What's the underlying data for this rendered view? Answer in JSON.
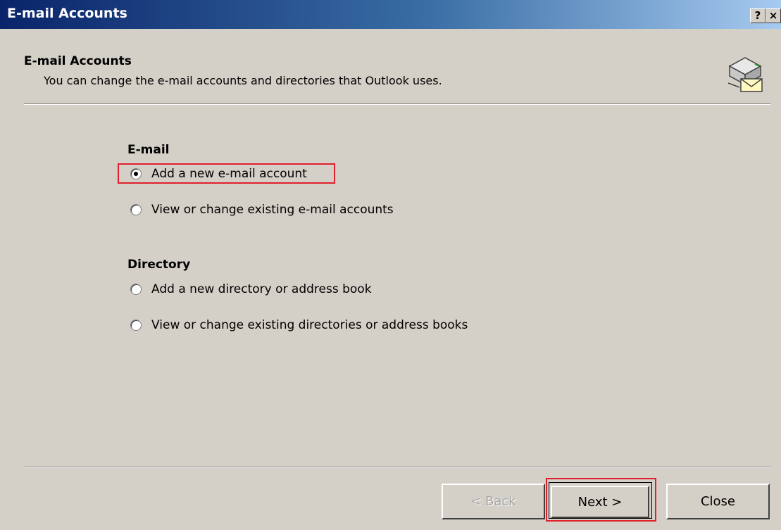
{
  "window": {
    "title": "E-mail Accounts",
    "help_label": "?",
    "close_label": "×"
  },
  "header": {
    "title": "E-mail Accounts",
    "description": "You can change the e-mail accounts and directories that Outlook uses.",
    "icon": "mail-server-icon"
  },
  "email_group": {
    "heading": "E-mail",
    "options": [
      {
        "label": "Add a new e-mail account",
        "checked": true
      },
      {
        "label": "View or change existing e-mail accounts",
        "checked": false
      }
    ]
  },
  "directory_group": {
    "heading": "Directory",
    "options": [
      {
        "label": "Add a new directory or address book",
        "checked": false
      },
      {
        "label": "View or change existing directories or address books",
        "checked": false
      }
    ]
  },
  "buttons": {
    "back_label": "< Back",
    "next_label": "Next >",
    "close_label": "Close"
  },
  "colors": {
    "highlight": "#e0202a",
    "dialog_bg": "#d4d0c8",
    "title_bar": "#0a246a"
  }
}
